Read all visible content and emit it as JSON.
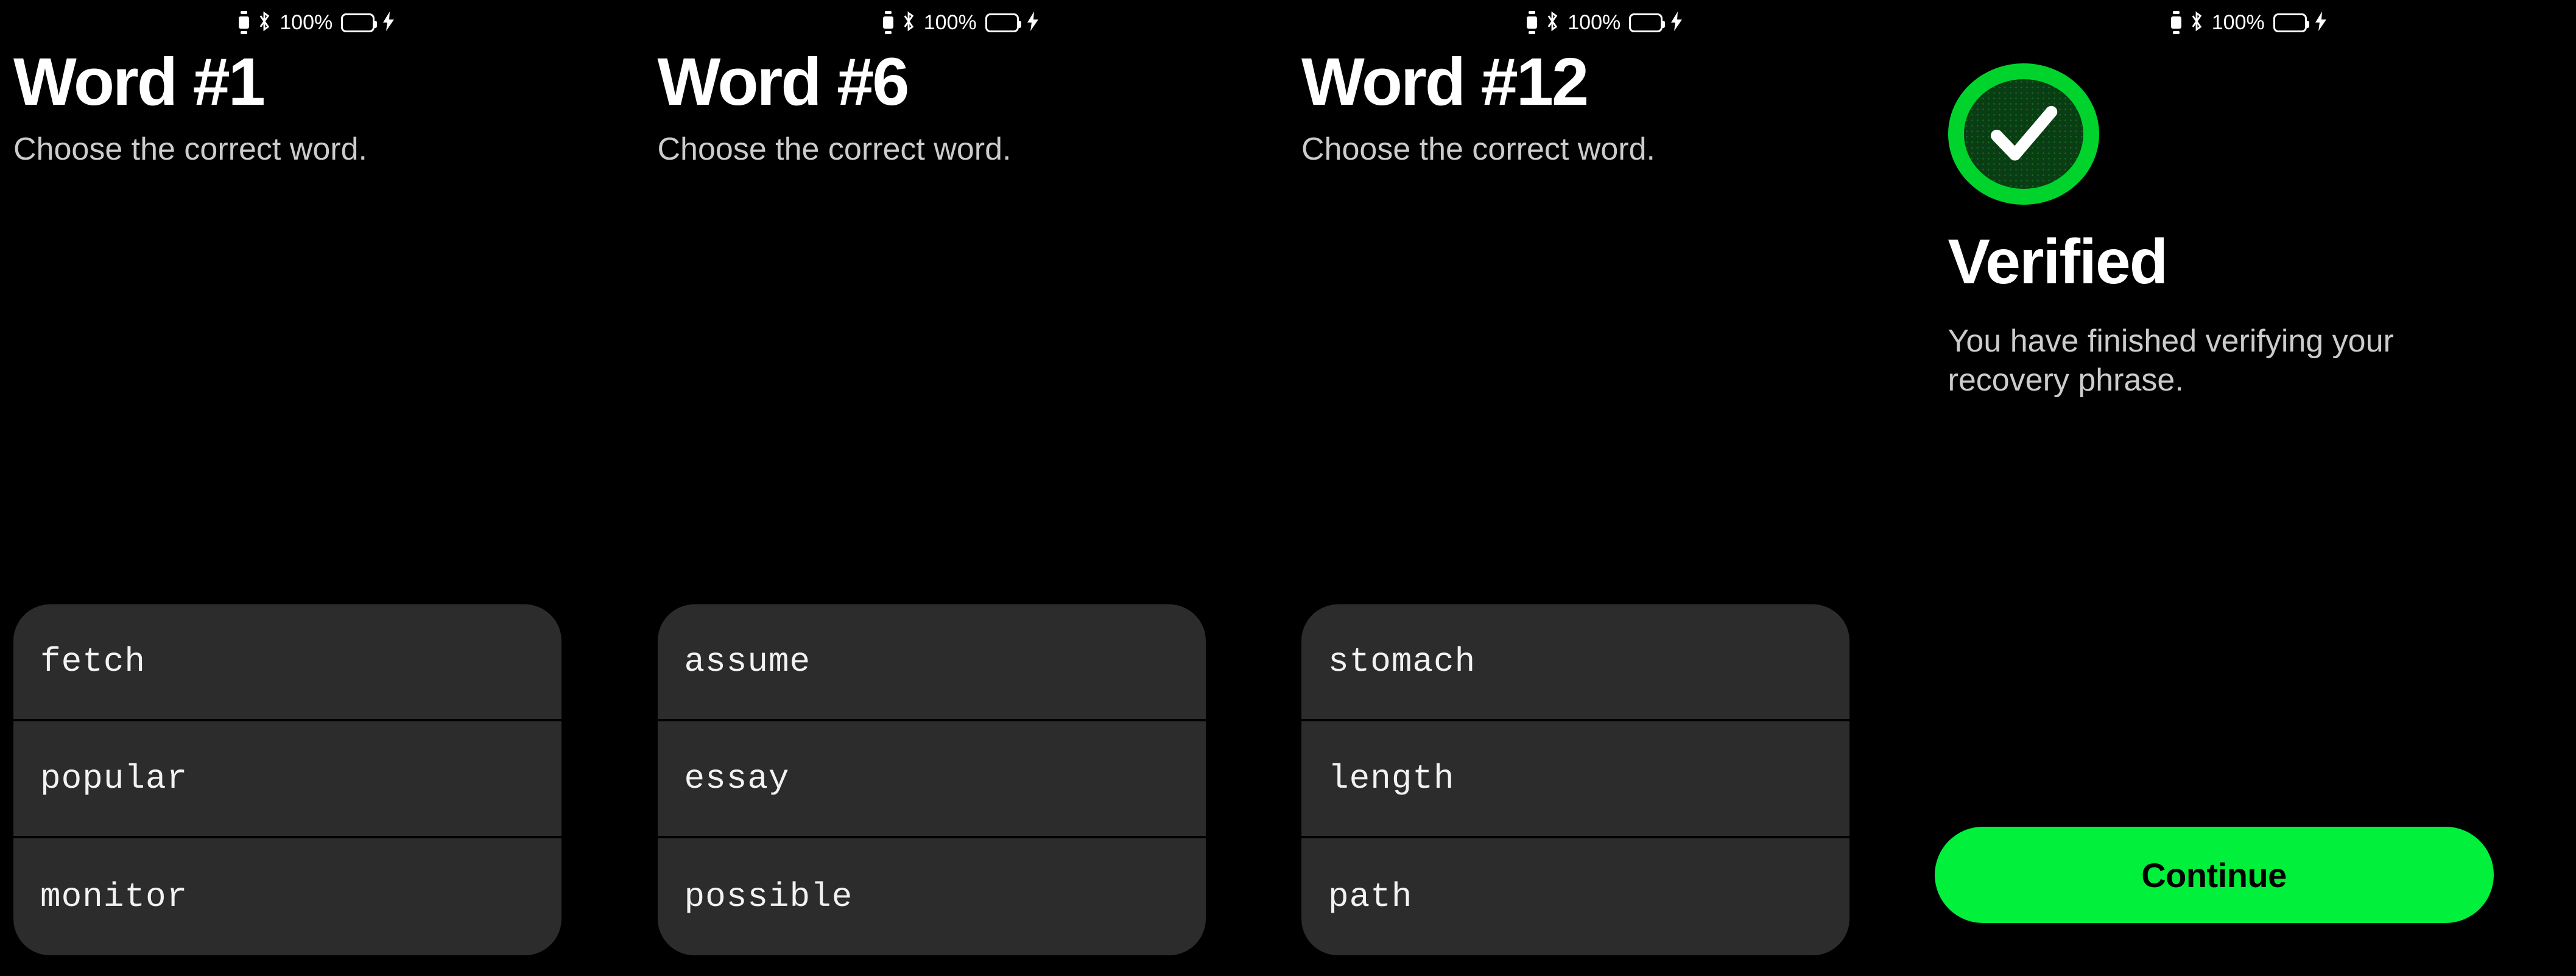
{
  "status_bar": {
    "battery_percent": "100%",
    "icons": [
      "watch-icon",
      "bluetooth-icon",
      "battery-icon",
      "charging-bolt-icon"
    ],
    "battery_fill_color": "#12F028",
    "charging": true
  },
  "theme": {
    "background": "#000000",
    "accent_green": "#00F03C",
    "badge_ring_green": "#00D42C",
    "row_background": "#2C2C2C",
    "subtitle_gray": "#CCCCCC"
  },
  "panels": [
    {
      "id": "word-1",
      "title": "Word #1",
      "subtitle": "Choose the correct word.",
      "choices": [
        "fetch",
        "popular",
        "monitor"
      ]
    },
    {
      "id": "word-6",
      "title": "Word #6",
      "subtitle": "Choose the correct word.",
      "choices": [
        "assume",
        "essay",
        "possible"
      ]
    },
    {
      "id": "word-12",
      "title": "Word #12",
      "subtitle": "Choose the correct word.",
      "choices": [
        "stomach",
        "length",
        "path"
      ]
    }
  ],
  "verified_panel": {
    "id": "verified",
    "badge_icon": "check-circle-icon",
    "title": "Verified",
    "subtitle": "You have finished verifying your recovery phrase.",
    "continue_label": "Continue"
  }
}
